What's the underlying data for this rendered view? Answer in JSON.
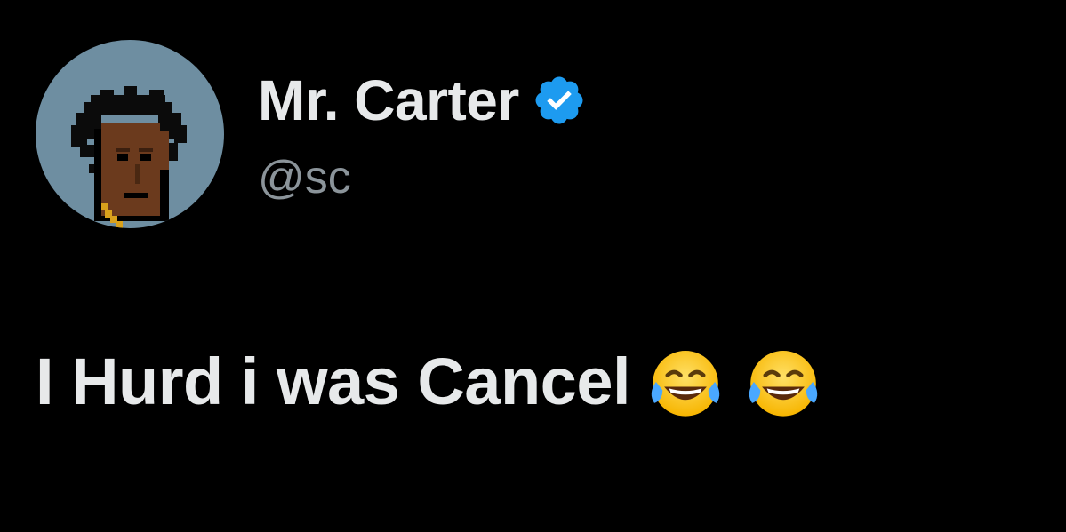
{
  "tweet": {
    "author": {
      "display_name": "Mr. Carter",
      "handle": "@sc",
      "verified": true,
      "verified_color": "#1d9bf0",
      "avatar_icon": "pixel-art-portrait-avatar",
      "avatar_background": "#6e8ea1"
    },
    "text": "I Hurd i was Cancel",
    "emojis": [
      "face-with-tears-of-joy",
      "face-with-tears-of-joy"
    ]
  },
  "colors": {
    "background": "#000000",
    "text_primary": "#e7e9ea",
    "text_secondary": "#8b949a"
  }
}
